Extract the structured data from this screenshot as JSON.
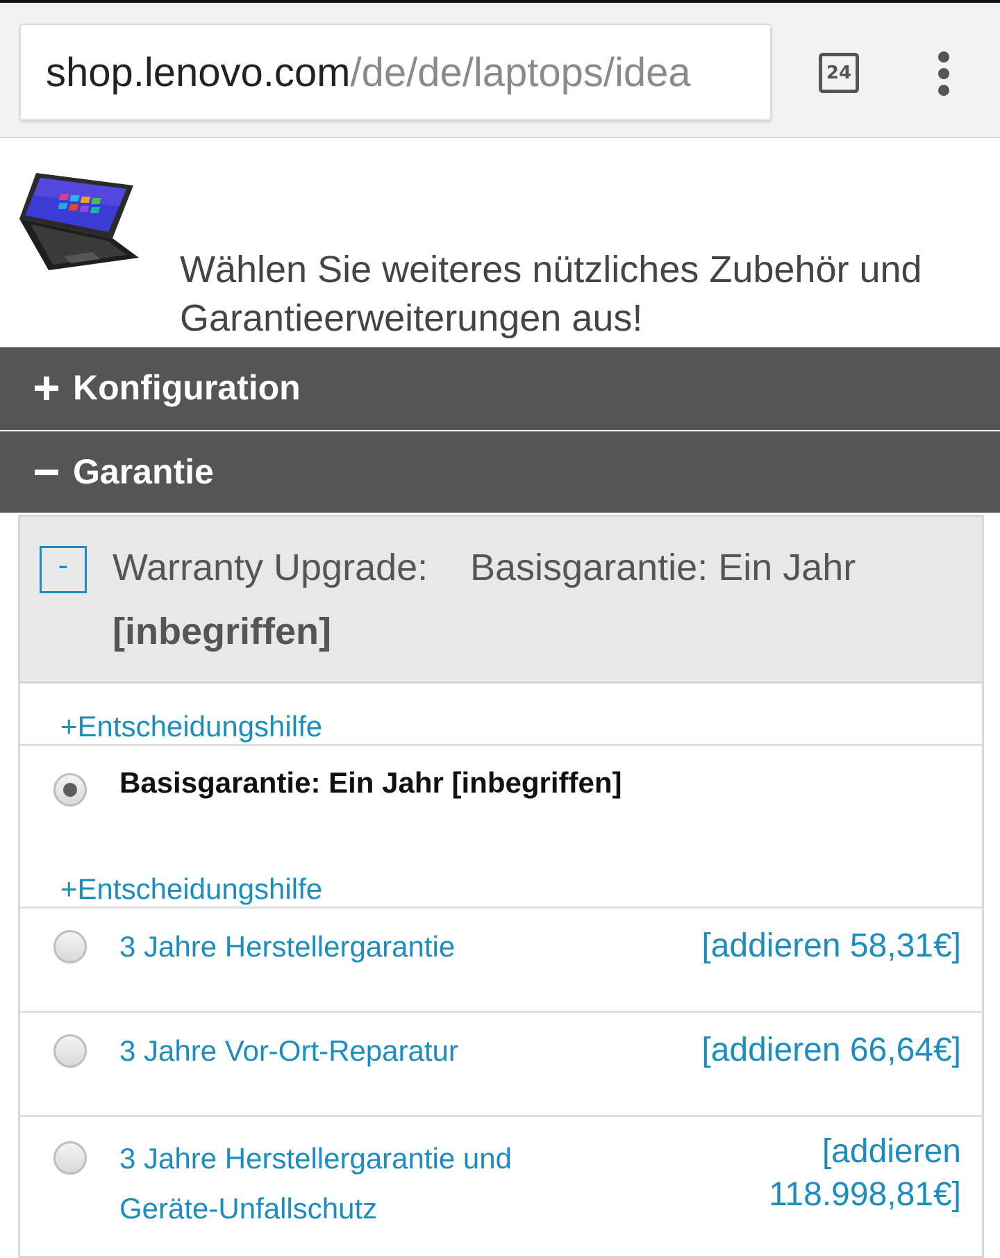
{
  "browser": {
    "url_host": "shop.lenovo.com",
    "url_path": "/de/de/laptops/idea",
    "tab_count": "24"
  },
  "product": {
    "prompt": "Wählen Sie weiteres nützliches Zubehör und Garantieerweiterungen aus!"
  },
  "accordion": {
    "konfiguration": "Konfiguration",
    "garantie": "Garantie"
  },
  "warranty": {
    "collapse_symbol": "-",
    "label": "Warranty Upgrade:",
    "current_value": "Basisgarantie: Ein Jahr",
    "current_value_2": "[inbegriffen]",
    "help_link": "+Entscheidungshilfe",
    "options": [
      {
        "label": "Basisgarantie: Ein Jahr [inbegriffen]",
        "price": "",
        "selected": true,
        "help": "+Entscheidungshilfe"
      },
      {
        "label": "3 Jahre Herstellergarantie",
        "price": "[addieren 58,31€]",
        "selected": false
      },
      {
        "label": "3 Jahre Vor-Ort-Reparatur",
        "price": "[addieren 66,64€]",
        "selected": false
      },
      {
        "label_line1": "3 Jahre Herstellergarantie und",
        "label_line2": "Geräte-Unfallschutz",
        "price_line1": "[addieren",
        "price_line2": "118.998,81€]",
        "selected": false
      }
    ]
  },
  "colors": {
    "link_blue": "#1b8dc1",
    "accordion_bg": "#555555",
    "panel_head_bg": "#e8e8e8"
  },
  "icons": [
    "laptop-product-image",
    "tab-switcher-icon",
    "overflow-menu-icon",
    "expand-plus-icon",
    "collapse-minus-icon"
  ]
}
